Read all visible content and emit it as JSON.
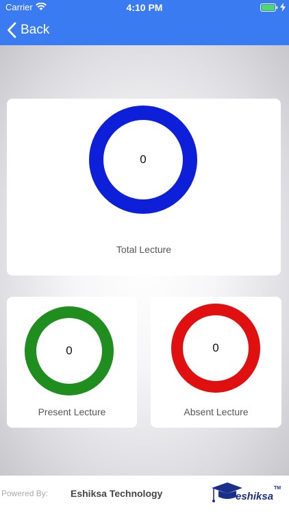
{
  "status_bar": {
    "carrier": "Carrier",
    "time": "4:10 PM"
  },
  "nav": {
    "back_label": "Back"
  },
  "cards": {
    "total": {
      "value": "0",
      "label": "Total Lecture",
      "color": "#0d1fd8"
    },
    "present": {
      "value": "0",
      "label": "Present Lecture",
      "color": "#1f8e1f"
    },
    "absent": {
      "value": "0",
      "label": "Absent Lecture",
      "color": "#e01010"
    }
  },
  "footer": {
    "powered_by": "Powered By:",
    "company": "Eshiksa Technology",
    "logo_text": "eshiksa",
    "logo_tm": "TM"
  },
  "colors": {
    "header": "#3b7bf2",
    "battery": "#4cd964"
  }
}
